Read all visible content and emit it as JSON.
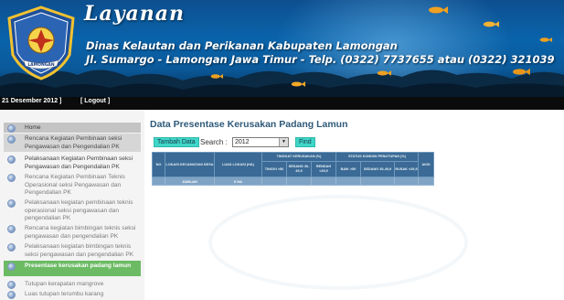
{
  "banner": {
    "title": "Layanan",
    "line1": "Dinas Kelautan dan Perikanan Kabupaten Lamongan",
    "line2": "Jl. Sumargo - Lamongan Jawa Timur - Telp. (0322) 7737655 atau (0322) 321039",
    "emblem_text": "LAMONGAN"
  },
  "topbar": {
    "date_text": "21 Desember 2012 ]",
    "logout_label": "[ Logout ]"
  },
  "sidebar": {
    "items": [
      {
        "label": "Home"
      },
      {
        "label": "Rencana Kegiatan Pembinaan seksi Pengawasan dan Pengendalian PK"
      },
      {
        "label": "Pelaksanaan Kegiatan Pembinaan seksi Pengawasan dan Pengendalian PK"
      },
      {
        "label": "Rencana Kegiatan Pembinaan Teknis Operasional seksi Pengawasan dan Pengendalian PK"
      },
      {
        "label": "Pelaksanaan kegiatan pembinaan teknis operasional seksi pengawasan dan pengendalian PK"
      },
      {
        "label": "Rencana kegiatan bimbingan teknis seksi pengawasan dan pengendalian PK"
      },
      {
        "label": "Pelaksanaan kegiatan bimbingan teknis seksi pengawasan dan pengendalian PK"
      },
      {
        "label": "Presentase kerusakan padang lamun"
      },
      {
        "label": "Tutupan kerapatan mangrove"
      },
      {
        "label": "Luas tutupan terumbu karang"
      }
    ],
    "active_index": 7
  },
  "main": {
    "title": "Data Presentase Kerusakan Padang Lamun",
    "add_label": "Tambah Data",
    "search_label": "Search :",
    "year_value": "2012",
    "find_label": "Find"
  },
  "table": {
    "header": {
      "no": "NO",
      "lokasi": "LOKASI KECAMATAN/ DESA",
      "luas": "LUAS LOKASI (HA)",
      "tingkat": "TINGKAT KERUSAKAN (%)",
      "status": "STATUS KONDISI PENUTUPAN (%)",
      "aksi": "AKSI"
    },
    "subheaders": [
      "TINGGI >50",
      "SEDANG 30-49,9",
      "RENDAH <29,9",
      "BAIK >50",
      "SEDANG 30-49,9",
      "RUSAK <29,9"
    ],
    "total_label": "JUMLAH",
    "total_value": "0 HA"
  },
  "colors": {
    "banner_blue": "#0a63aa",
    "active_green": "#6cbb64",
    "button_teal": "#3fd6c8",
    "table_header": "#3a6a95",
    "title_blue": "#2e5a7a"
  }
}
